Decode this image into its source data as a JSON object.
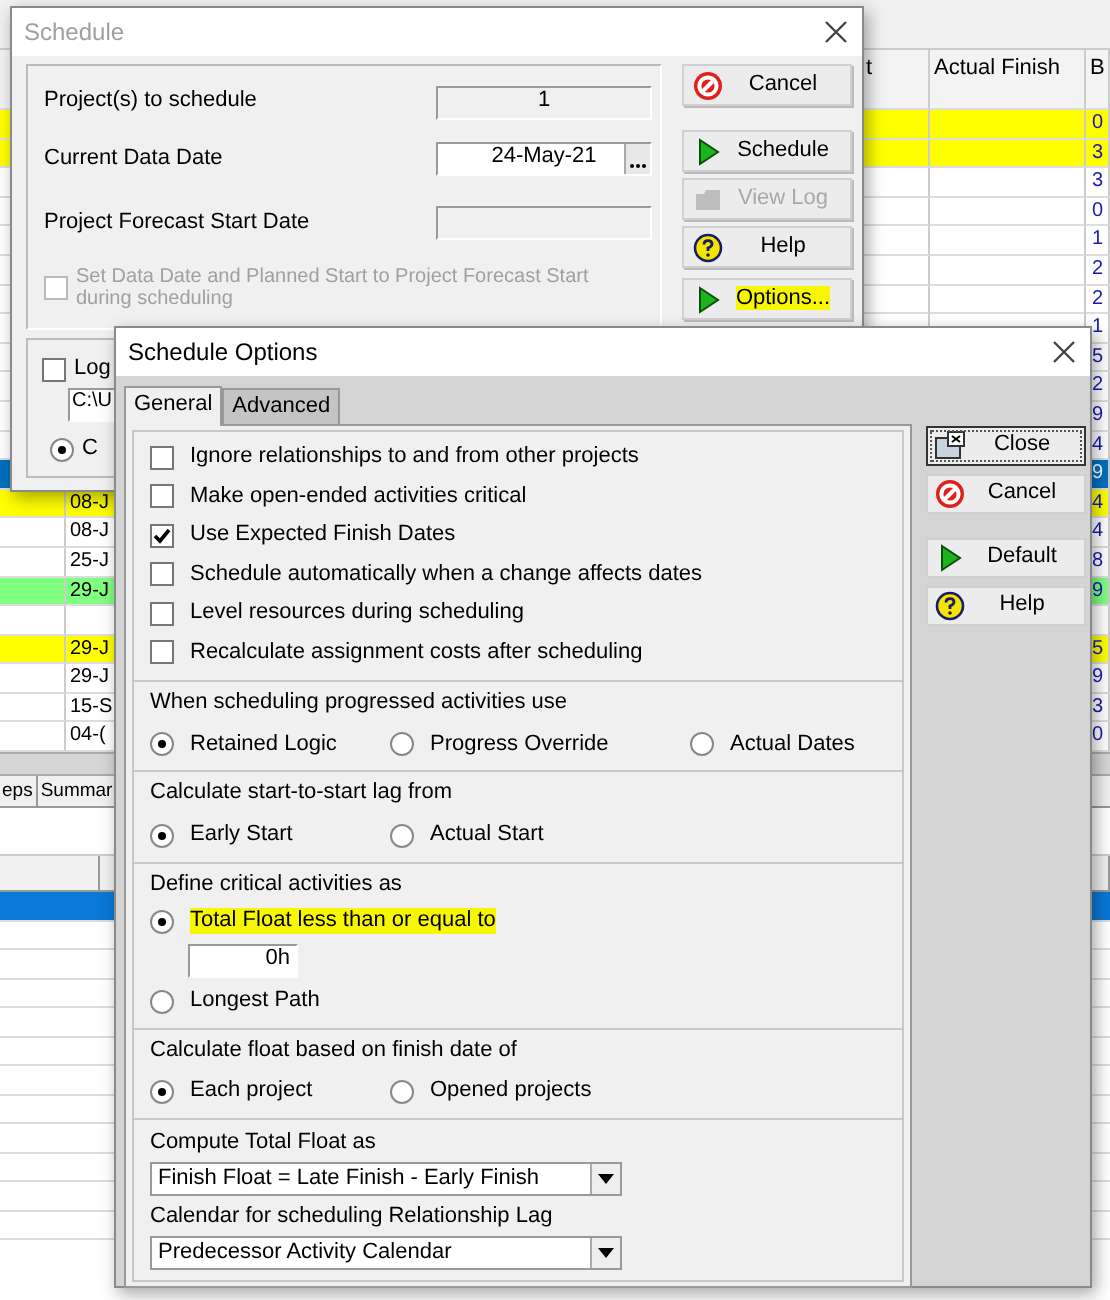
{
  "app_table": {
    "columns": [
      {
        "label": "t"
      },
      {
        "label": "Actual Finish"
      },
      {
        "label": "B"
      }
    ],
    "rows": [
      {
        "color": "#ffff00",
        "bl": "0"
      },
      {
        "color": "#ffff00",
        "bl": "3"
      },
      {
        "color": "#ffffff",
        "bl": "3"
      },
      {
        "color": "#ffffff",
        "bl": "0"
      },
      {
        "color": "#ffffff",
        "bl": "1"
      },
      {
        "color": "#ffffff",
        "bl": "2"
      },
      {
        "color": "#ffffff",
        "bl": "2"
      },
      {
        "color": "#ffffff",
        "bl": "1"
      },
      {
        "color": "#ffffff",
        "bl": "5"
      },
      {
        "color": "#ffffff",
        "bl": "2"
      },
      {
        "color": "#ffffff",
        "bl": "9"
      },
      {
        "color": "#ffffff",
        "bl": "4"
      },
      {
        "color": "#0070c0",
        "bl": "9"
      },
      {
        "color": "#ffff00",
        "date": "08-J",
        "bl": "4"
      },
      {
        "color": "#ffffff",
        "date": "08-J",
        "bl": "4"
      },
      {
        "color": "#ffffff",
        "date": "25-J",
        "bl": "8"
      },
      {
        "color": "#80ff80",
        "date": "29-J",
        "bl": "9"
      },
      {
        "color": "#ffffff"
      },
      {
        "color": "#ffff00",
        "date": "29-J",
        "bl": "5"
      },
      {
        "color": "#ffffff",
        "date": "29-J",
        "bl": "9"
      },
      {
        "color": "#ffffff",
        "date": "15-S",
        "bl": "3"
      },
      {
        "color": "#ffffff",
        "date": "04-(",
        "bl": "0"
      }
    ]
  },
  "lower_pane": {
    "tabs": [
      {
        "label": "eps"
      },
      {
        "label": "Summar"
      }
    ],
    "rows": [
      {
        "selected": true
      },
      {
        "selected": false
      },
      {
        "selected": false
      },
      {
        "selected": false
      },
      {
        "selected": false
      },
      {
        "selected": false
      },
      {
        "selected": false
      },
      {
        "selected": false
      },
      {
        "selected": false
      },
      {
        "selected": false
      },
      {
        "selected": false
      },
      {
        "selected": false
      }
    ]
  },
  "schedule_dialog": {
    "title": "Schedule",
    "fields": [
      {
        "label": "Project(s) to schedule",
        "value": "1",
        "kind": "readonly"
      },
      {
        "label": "Current Data Date",
        "value": "24-May-21",
        "kind": "date"
      },
      {
        "label": "Project Forecast Start Date",
        "kind": "readonly"
      }
    ],
    "set_data_date": {
      "label": "Set Data Date and Planned Start to Project Forecast Start during scheduling",
      "checked": false,
      "disabled": true
    },
    "log": {
      "label": "Log",
      "checked": false,
      "path": "C:\\U",
      "option": {
        "label": "C",
        "selected": true
      }
    },
    "buttons": [
      {
        "label": "Cancel",
        "kind": "cancel",
        "disabled": false,
        "highlighted": false
      },
      {
        "label": "Schedule",
        "kind": "run",
        "disabled": false,
        "highlighted": false
      },
      {
        "label": "View Log",
        "kind": "log",
        "disabled": true,
        "highlighted": false
      },
      {
        "label": "Help",
        "kind": "help",
        "disabled": false,
        "highlighted": false
      },
      {
        "label": "Options...",
        "kind": "run",
        "disabled": false,
        "highlighted": true
      }
    ]
  },
  "options_dialog": {
    "title": "Schedule Options",
    "tabs": [
      {
        "label": "General",
        "selected": true
      },
      {
        "label": "Advanced",
        "selected": false
      }
    ],
    "checkboxes": [
      {
        "label": "Ignore relationships to and from other projects",
        "checked": false
      },
      {
        "label": "Make open-ended activities critical",
        "checked": false
      },
      {
        "label": "Use Expected Finish Dates",
        "checked": true
      },
      {
        "label": "Schedule automatically when a change affects dates",
        "checked": false
      },
      {
        "label": "Level resources during scheduling",
        "checked": false
      },
      {
        "label": "Recalculate assignment costs after scheduling",
        "checked": false
      }
    ],
    "groups": [
      {
        "label": "When scheduling progressed activities use",
        "kind": "row",
        "options": [
          {
            "label": "Retained Logic",
            "selected": true
          },
          {
            "label": "Progress Override",
            "selected": false
          },
          {
            "label": "Actual Dates",
            "selected": false
          }
        ]
      },
      {
        "label": "Calculate start-to-start lag from",
        "kind": "row",
        "options": [
          {
            "label": "Early Start",
            "selected": true
          },
          {
            "label": "Actual Start",
            "selected": false
          }
        ]
      },
      {
        "label": "Define critical activities as",
        "kind": "stack",
        "options": [
          {
            "label": "Total Float less than or equal to",
            "selected": true,
            "highlighted": true,
            "value": "0h"
          },
          {
            "label": "Longest Path",
            "selected": false,
            "highlighted": false
          }
        ]
      },
      {
        "label": "Calculate float based on finish date of",
        "kind": "row",
        "options": [
          {
            "label": "Each project",
            "selected": true
          },
          {
            "label": "Opened projects",
            "selected": false
          }
        ]
      }
    ],
    "dropdowns": [
      {
        "label": "Compute Total Float as",
        "value": "Finish Float = Late Finish - Early Finish"
      },
      {
        "label": "Calendar for scheduling Relationship Lag",
        "value": "Predecessor Activity Calendar"
      }
    ],
    "buttons": [
      {
        "label": "Close",
        "kind": "close",
        "focused": true
      },
      {
        "label": "Cancel",
        "kind": "cancel",
        "focused": false
      },
      {
        "label": "Default",
        "kind": "run",
        "focused": false
      },
      {
        "label": "Help",
        "kind": "help",
        "focused": false
      }
    ]
  }
}
